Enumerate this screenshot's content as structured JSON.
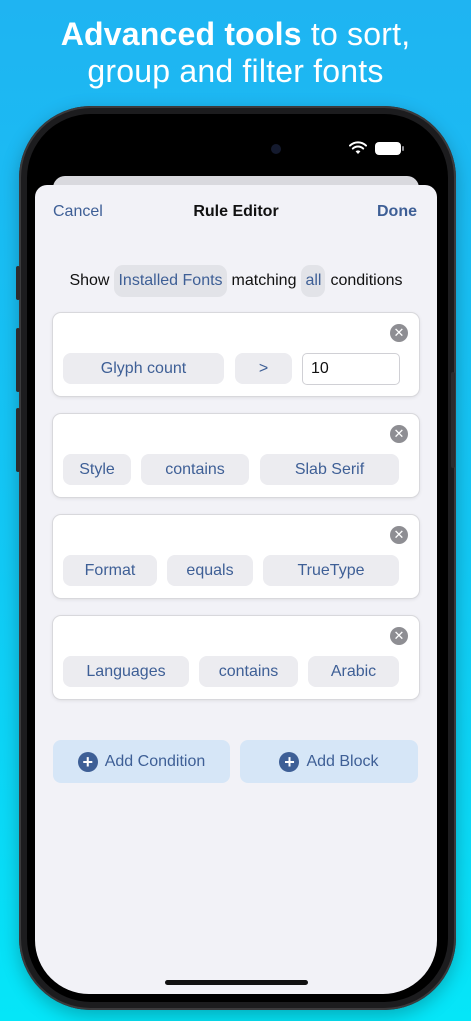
{
  "headline": {
    "bold": "Advanced tools",
    "rest_line1": "to sort,",
    "line2": "group and filter fonts"
  },
  "nav": {
    "cancel": "Cancel",
    "title": "Rule Editor",
    "done": "Done"
  },
  "show_row": {
    "prefix": "Show",
    "source": "Installed Fonts",
    "middle": "matching",
    "mode": "all",
    "suffix": "conditions"
  },
  "conditions": [
    {
      "field": "Glyph count",
      "operator": ">",
      "value": "10"
    },
    {
      "field": "Style",
      "operator": "contains",
      "value": "Slab Serif"
    },
    {
      "field": "Format",
      "operator": "equals",
      "value": "TrueType"
    },
    {
      "field": "Languages",
      "operator": "contains",
      "value": "Arabic"
    }
  ],
  "actions": {
    "add_condition": "Add Condition",
    "add_block": "Add Block"
  },
  "colors": {
    "accent": "#3e5f96",
    "sheet_background": "#f2f2f7",
    "button_background": "#d6e6f7"
  }
}
